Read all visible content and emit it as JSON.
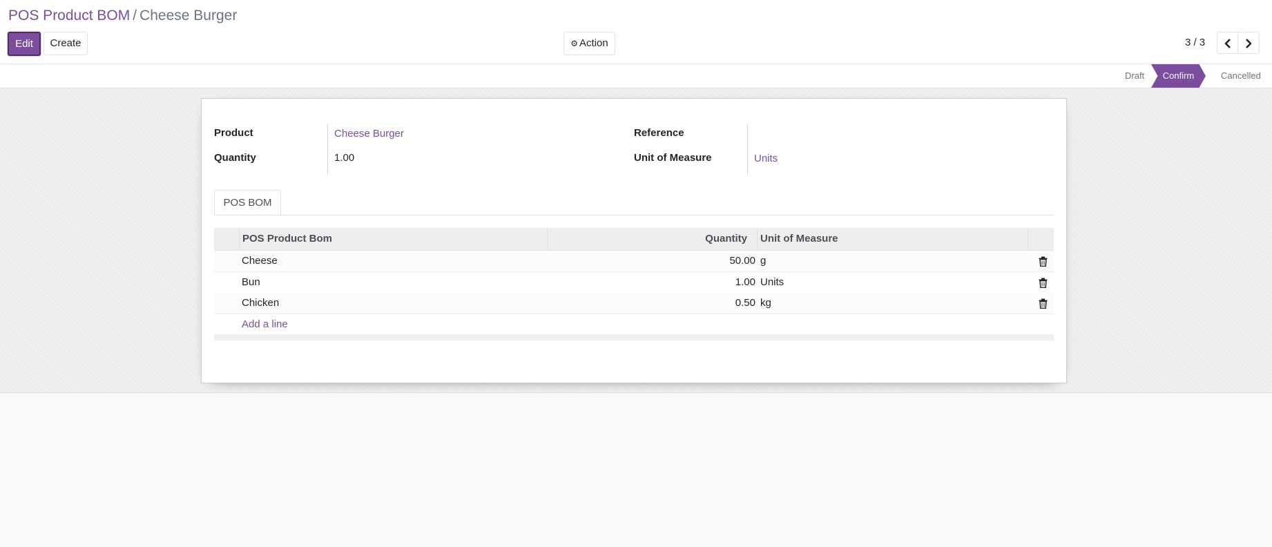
{
  "breadcrumb": {
    "parent": "POS Product BOM",
    "separator": "/",
    "current": "Cheese Burger"
  },
  "toolbar": {
    "edit_label": "Edit",
    "create_label": "Create",
    "action_label": "Action",
    "action_icon": "gear-icon"
  },
  "pager": {
    "value": "3 / 3",
    "prev_icon": "chevron-left-icon",
    "next_icon": "chevron-right-icon"
  },
  "statusbar": {
    "stages": [
      {
        "label": "Draft",
        "active": false
      },
      {
        "label": "Confirm",
        "active": true
      },
      {
        "label": "Cancelled",
        "active": false
      }
    ]
  },
  "form": {
    "product_label": "Product",
    "product_value": "Cheese Burger",
    "quantity_label": "Quantity",
    "quantity_value": "1.00",
    "reference_label": "Reference",
    "reference_value": "",
    "uom_label": "Unit of Measure",
    "uom_value": "Units"
  },
  "tabs": [
    {
      "label": "POS BOM",
      "active": true
    }
  ],
  "bom_list": {
    "columns": [
      "POS Product Bom",
      "Quantity",
      "Unit of Measure"
    ],
    "rows": [
      {
        "product": "Cheese",
        "quantity": "50.00",
        "uom": "g"
      },
      {
        "product": "Bun",
        "quantity": "1.00",
        "uom": "Units"
      },
      {
        "product": "Chicken",
        "quantity": "0.50",
        "uom": "kg"
      }
    ],
    "add_line_label": "Add a line",
    "row_delete_icon": "trash-icon"
  },
  "colors": {
    "brand": "#7c4c9e",
    "brand_dark": "#4c2e62",
    "muted_text": "#6c757d"
  }
}
